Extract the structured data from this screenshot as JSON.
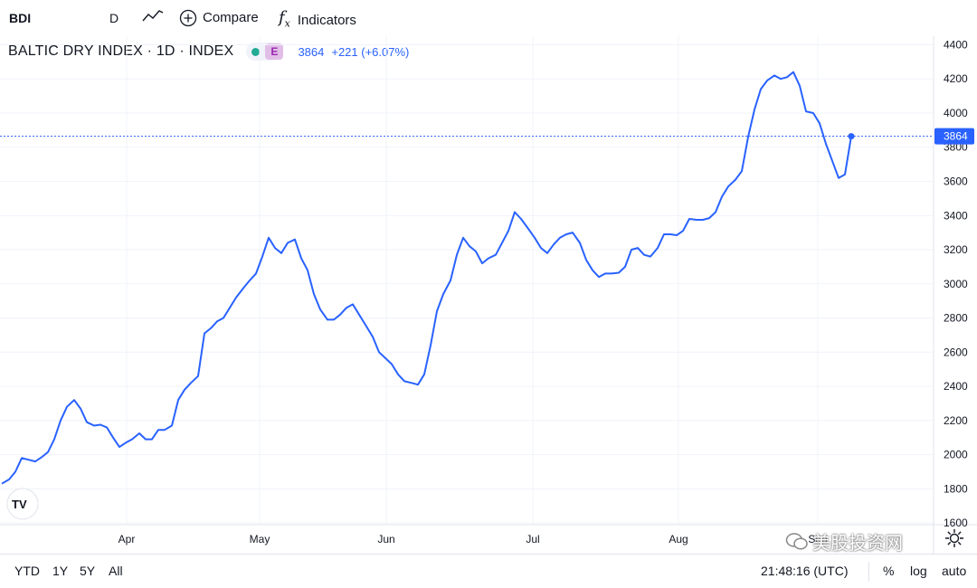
{
  "toolbar": {
    "symbol": "BDI",
    "interval": "D",
    "compare_label": "Compare",
    "indicators_label": "Indicators",
    "icons": [
      "line-chart-icon",
      "plus-circle-icon",
      "fx-icon"
    ]
  },
  "legend": {
    "title": "BALTIC DRY INDEX · 1D · INDEX",
    "badge": "E",
    "price": "3864",
    "change": "+221 (+6.07%)"
  },
  "price_label": "3864",
  "tv_logo": "TV",
  "bottom": {
    "ranges": [
      "YTD",
      "1Y",
      "5Y",
      "All"
    ],
    "time": "21:48:16 (UTC)",
    "percent": "%",
    "log": "log",
    "auto": "auto"
  },
  "watermark": "美股投资网",
  "colors": {
    "line": "#2962ff",
    "accent": "#2962ff",
    "badge_dot": "#22ab94",
    "badge_e": "#9c27b0"
  },
  "chart_data": {
    "type": "line",
    "series": [
      {
        "values": [
          [
            0,
            1830
          ],
          [
            8,
            1855
          ],
          [
            15,
            1900
          ],
          [
            22,
            1980
          ],
          [
            30,
            1970
          ],
          [
            37,
            1960
          ],
          [
            44,
            1985
          ],
          [
            51,
            2015
          ],
          [
            58,
            2090
          ],
          [
            65,
            2200
          ],
          [
            72,
            2280
          ],
          [
            80,
            2320
          ],
          [
            87,
            2270
          ],
          [
            94,
            2190
          ],
          [
            102,
            2170
          ],
          [
            109,
            2175
          ],
          [
            116,
            2160
          ],
          [
            123,
            2100
          ],
          [
            130,
            2045
          ],
          [
            137,
            2070
          ],
          [
            144,
            2090
          ],
          [
            152,
            2125
          ],
          [
            159,
            2090
          ],
          [
            166,
            2090
          ],
          [
            173,
            2145
          ],
          [
            180,
            2145
          ],
          [
            188,
            2170
          ],
          [
            195,
            2320
          ],
          [
            202,
            2380
          ],
          [
            209,
            2420
          ],
          [
            217,
            2460
          ],
          [
            224,
            2710
          ],
          [
            231,
            2740
          ],
          [
            238,
            2780
          ],
          [
            245,
            2800
          ],
          [
            252,
            2860
          ],
          [
            259,
            2920
          ],
          [
            267,
            2975
          ],
          [
            274,
            3020
          ],
          [
            281,
            3060
          ],
          [
            288,
            3160
          ],
          [
            295,
            3270
          ],
          [
            302,
            3210
          ],
          [
            309,
            3180
          ],
          [
            316,
            3240
          ],
          [
            324,
            3260
          ],
          [
            331,
            3150
          ],
          [
            338,
            3080
          ],
          [
            345,
            2940
          ],
          [
            352,
            2850
          ],
          [
            360,
            2790
          ],
          [
            367,
            2790
          ],
          [
            374,
            2820
          ],
          [
            381,
            2860
          ],
          [
            388,
            2880
          ],
          [
            395,
            2820
          ],
          [
            402,
            2760
          ],
          [
            410,
            2690
          ],
          [
            417,
            2600
          ],
          [
            424,
            2565
          ],
          [
            431,
            2530
          ],
          [
            438,
            2470
          ],
          [
            445,
            2430
          ],
          [
            453,
            2420
          ],
          [
            460,
            2410
          ],
          [
            467,
            2470
          ],
          [
            474,
            2640
          ],
          [
            481,
            2840
          ],
          [
            488,
            2940
          ],
          [
            496,
            3020
          ],
          [
            503,
            3170
          ],
          [
            510,
            3270
          ],
          [
            517,
            3220
          ],
          [
            524,
            3190
          ],
          [
            531,
            3120
          ],
          [
            538,
            3150
          ],
          [
            546,
            3170
          ],
          [
            553,
            3240
          ],
          [
            560,
            3310
          ],
          [
            567,
            3420
          ],
          [
            574,
            3380
          ],
          [
            581,
            3330
          ],
          [
            589,
            3270
          ],
          [
            596,
            3210
          ],
          [
            603,
            3180
          ],
          [
            610,
            3230
          ],
          [
            617,
            3270
          ],
          [
            624,
            3290
          ],
          [
            631,
            3300
          ],
          [
            639,
            3240
          ],
          [
            646,
            3140
          ],
          [
            653,
            3080
          ],
          [
            660,
            3040
          ],
          [
            667,
            3060
          ],
          [
            674,
            3060
          ],
          [
            682,
            3065
          ],
          [
            689,
            3100
          ],
          [
            696,
            3200
          ],
          [
            703,
            3210
          ],
          [
            710,
            3170
          ],
          [
            717,
            3160
          ],
          [
            725,
            3210
          ],
          [
            732,
            3290
          ],
          [
            739,
            3290
          ],
          [
            746,
            3285
          ],
          [
            753,
            3310
          ],
          [
            760,
            3380
          ],
          [
            768,
            3375
          ],
          [
            775,
            3375
          ],
          [
            782,
            3385
          ],
          [
            789,
            3420
          ],
          [
            796,
            3510
          ],
          [
            803,
            3570
          ],
          [
            811,
            3610
          ],
          [
            818,
            3660
          ],
          [
            825,
            3860
          ],
          [
            832,
            4020
          ],
          [
            839,
            4140
          ],
          [
            846,
            4190
          ],
          [
            854,
            4220
          ],
          [
            861,
            4200
          ],
          [
            868,
            4210
          ],
          [
            875,
            4240
          ],
          [
            882,
            4160
          ],
          [
            889,
            4010
          ],
          [
            897,
            4000
          ],
          [
            904,
            3940
          ],
          [
            911,
            3820
          ],
          [
            918,
            3720
          ],
          [
            925,
            3620
          ],
          [
            932,
            3640
          ],
          [
            939,
            3864
          ]
        ]
      }
    ],
    "x_ticks": [
      "Apr",
      "May",
      "Jun",
      "Jul",
      "Aug",
      "Sep"
    ],
    "y_ticks": [
      1600,
      1800,
      2000,
      2200,
      2400,
      2600,
      2800,
      3000,
      3200,
      3400,
      3600,
      3800,
      4000,
      4200,
      4400
    ],
    "ylim": [
      1590,
      4450
    ],
    "last_value": 3864,
    "grid": true
  }
}
